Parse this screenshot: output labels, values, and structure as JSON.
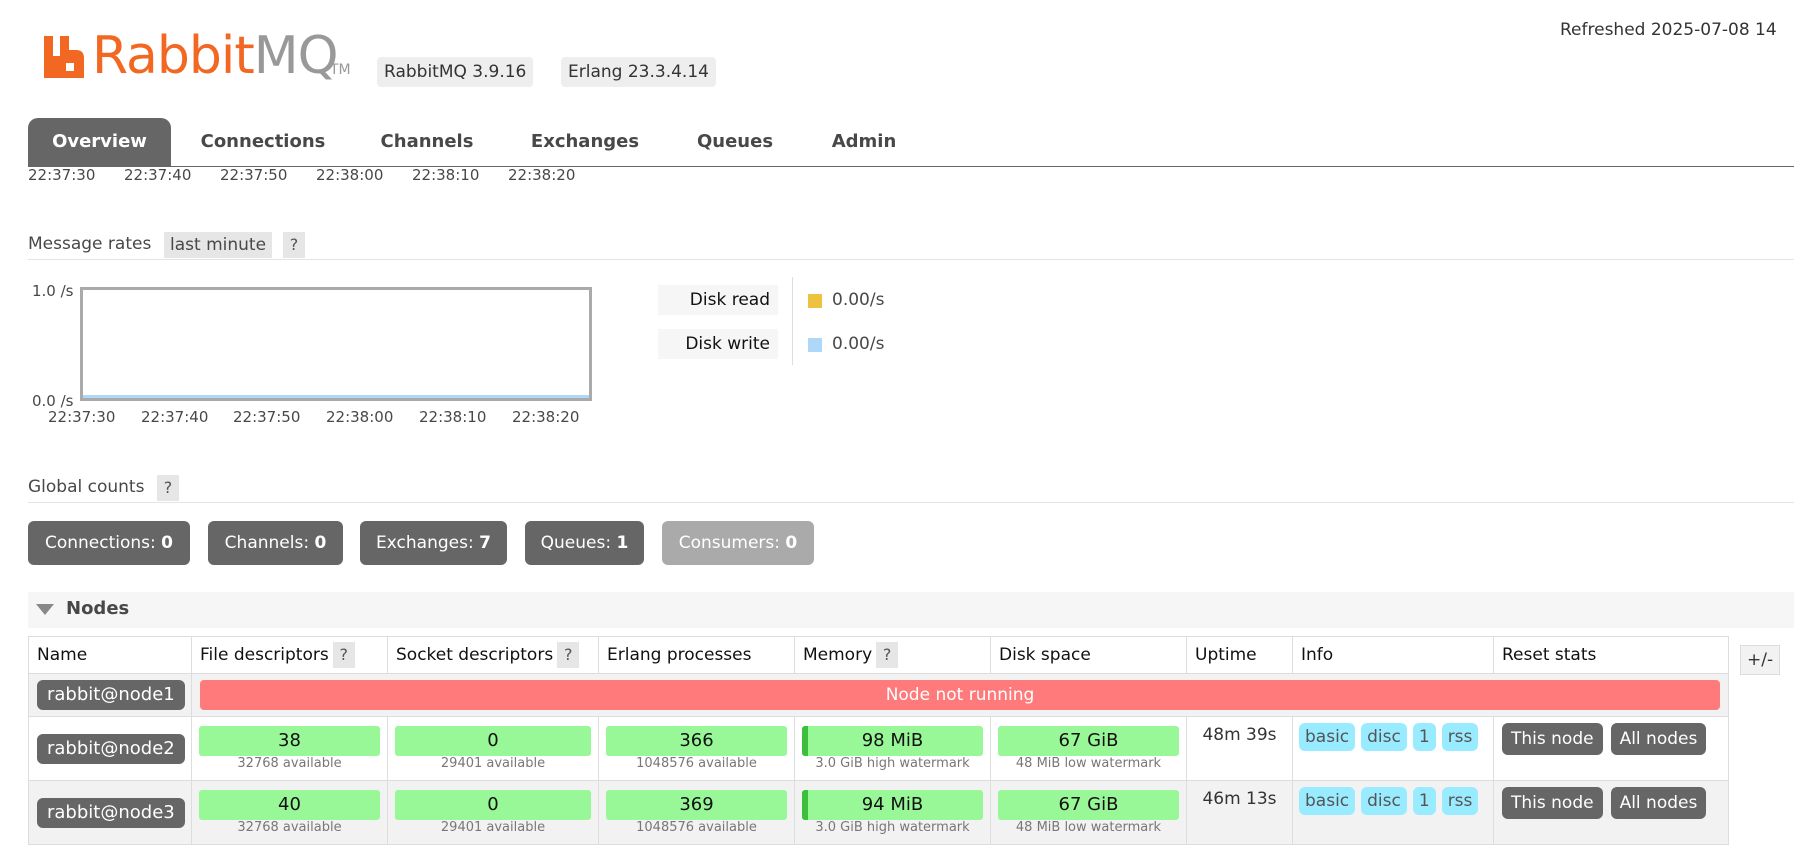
{
  "header": {
    "logo_main": "Rabbit",
    "logo_accent": "MQ",
    "logo_tm": "TM",
    "rabbitmq_version": "RabbitMQ 3.9.16",
    "erlang_version": "Erlang 23.3.4.14",
    "refreshed": "Refreshed 2025-07-08 14"
  },
  "tabs": [
    "Overview",
    "Connections",
    "Channels",
    "Exchanges",
    "Queues",
    "Admin"
  ],
  "active_tab": "Overview",
  "top_time_axis": [
    "22:37:30",
    "22:37:40",
    "22:37:50",
    "22:38:00",
    "22:38:10",
    "22:38:20"
  ],
  "message_rates": {
    "label": "Message rates",
    "range": "last minute",
    "help": "?",
    "y_top": "1.0 /s",
    "y_bottom": "0.0 /s",
    "x_ticks": [
      "22:37:30",
      "22:37:40",
      "22:37:50",
      "22:38:00",
      "22:38:10",
      "22:38:20"
    ],
    "legend": [
      {
        "label": "Disk read",
        "value": "0.00/s",
        "color": "#edc240"
      },
      {
        "label": "Disk write",
        "value": "0.00/s",
        "color": "#afd8f8"
      }
    ]
  },
  "global_counts": {
    "label": "Global counts",
    "help": "?",
    "items": [
      {
        "label": "Connections:",
        "value": "0"
      },
      {
        "label": "Channels:",
        "value": "0"
      },
      {
        "label": "Exchanges:",
        "value": "7"
      },
      {
        "label": "Queues:",
        "value": "1"
      },
      {
        "label": "Consumers:",
        "value": "0"
      }
    ]
  },
  "nodes": {
    "title": "Nodes",
    "plus_minus": "+/-",
    "columns": [
      "Name",
      "File descriptors",
      "Socket descriptors",
      "Erlang processes",
      "Memory",
      "Disk space",
      "Uptime",
      "Info",
      "Reset stats"
    ],
    "help": "?",
    "rows": [
      {
        "name": "rabbit@node1",
        "status": "Node not running"
      },
      {
        "name": "rabbit@node2",
        "fd": "38",
        "fd_sub": "32768 available",
        "sd": "0",
        "sd_sub": "29401 available",
        "ep": "366",
        "ep_sub": "1048576 available",
        "mem": "98 MiB",
        "mem_sub": "3.0 GiB high watermark",
        "disk": "67 GiB",
        "disk_sub": "48 MiB low watermark",
        "uptime": "48m 39s",
        "info": [
          "basic",
          "disc",
          "1",
          "rss"
        ],
        "reset": [
          "This node",
          "All nodes"
        ]
      },
      {
        "name": "rabbit@node3",
        "fd": "40",
        "fd_sub": "32768 available",
        "sd": "0",
        "sd_sub": "29401 available",
        "ep": "369",
        "ep_sub": "1048576 available",
        "mem": "94 MiB",
        "mem_sub": "3.0 GiB high watermark",
        "disk": "67 GiB",
        "disk_sub": "48 MiB low watermark",
        "uptime": "46m 13s",
        "info": [
          "basic",
          "disc",
          "1",
          "rss"
        ],
        "reset": [
          "This node",
          "All nodes"
        ]
      }
    ]
  }
}
